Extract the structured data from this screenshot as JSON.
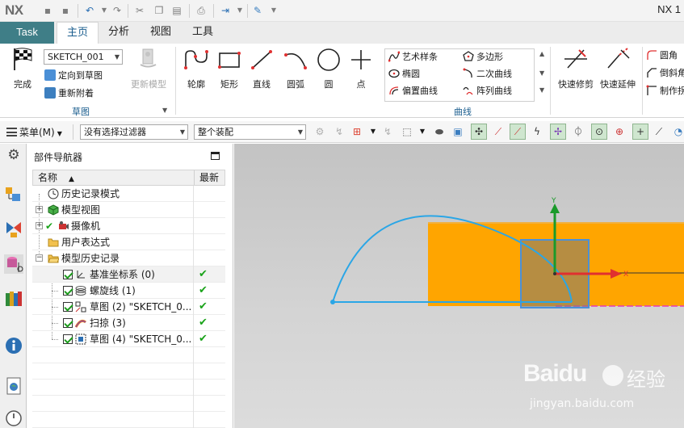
{
  "window": {
    "logo": "NX",
    "title": "NX 1"
  },
  "tabs": [
    "Task",
    "主页",
    "分析",
    "视图",
    "工具"
  ],
  "active_tab": "主页",
  "ribbon": {
    "finish_label": "完成",
    "sketch_combo": "SKETCH_001",
    "orient_label": "定向到草图",
    "reattach_label": "重新附着",
    "update_model_label": "更新模型",
    "sketch_group_label": "草图",
    "profile_label": "轮廓",
    "rectangle_label": "矩形",
    "line_label": "直线",
    "arc_label": "圆弧",
    "circle_label": "圆",
    "point_label": "点",
    "gallery": {
      "studio_spline": "艺术样条",
      "polygon": "多边形",
      "ellipse": "椭圆",
      "conic": "二次曲线",
      "offset_curve": "偏置曲线",
      "pattern_curve": "阵列曲线"
    },
    "curve_group_label": "曲线",
    "quick_trim_label": "快速修剪",
    "quick_extend_label": "快速延伸",
    "fillet_label": "圆角",
    "chamfer_label": "倒斜角",
    "make_corner_label": "制作拐"
  },
  "selection_bar": {
    "menu_label": "菜单(M)",
    "filter_value": "没有选择过滤器",
    "scope_value": "整个装配"
  },
  "navigator": {
    "title": "部件导航器",
    "col_name": "名称",
    "col_latest": "最新",
    "items": [
      {
        "label": "历史记录模式",
        "icon": "clock-icon",
        "latest": ""
      },
      {
        "label": "模型视图",
        "icon": "cube-view-icon",
        "latest": ""
      },
      {
        "label": "摄像机",
        "icon": "camera-icon",
        "latest": ""
      },
      {
        "label": "用户表达式",
        "icon": "folder-icon",
        "latest": ""
      },
      {
        "label": "模型历史记录",
        "icon": "folder-open-icon",
        "latest": ""
      },
      {
        "label": "基准坐标系 (0)",
        "icon": "datum-csys-icon",
        "latest": "✔"
      },
      {
        "label": "螺旋线 (1)",
        "icon": "helix-icon",
        "latest": "✔"
      },
      {
        "label": "草图 (2) \"SKETCH_0...",
        "icon": "sketch-icon",
        "latest": "✔"
      },
      {
        "label": "扫掠 (3)",
        "icon": "sweep-icon",
        "latest": "✔"
      },
      {
        "label": "草图 (4) \"SKETCH_0...",
        "icon": "sketch-icon",
        "latest": "✔"
      }
    ]
  },
  "viewport": {
    "axis_y": "Y",
    "axis_x": "X",
    "colors": {
      "solid": "#ffa500",
      "sketch_curve": "#2aa6e6",
      "axis_y": "#1a9a2a",
      "axis_x": "#e03030"
    }
  },
  "watermark": {
    "brand": "Baidu",
    "brand_cn": "经验",
    "url": "jingyan.baidu.com"
  }
}
